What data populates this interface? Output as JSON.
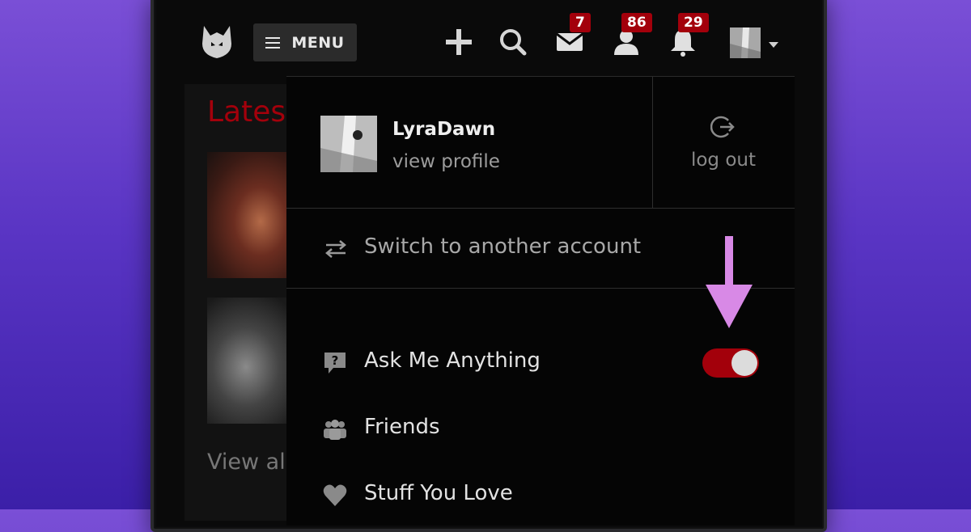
{
  "nav": {
    "menu_label": "MENU",
    "badges": {
      "messages": "7",
      "friends": "86",
      "notifications": "29"
    }
  },
  "background": {
    "heading": "Lates",
    "view_all": "View al"
  },
  "dropdown": {
    "username": "LyraDawn",
    "view_profile": "view profile",
    "log_out": "log out",
    "switch_account": "Switch to another account",
    "items": [
      {
        "label": "Ask Me Anything",
        "icon": "question-bubble-icon",
        "toggle": true,
        "toggle_on": true
      },
      {
        "label": "Friends",
        "icon": "friends-icon"
      },
      {
        "label": "Stuff You Love",
        "icon": "heart-icon"
      }
    ]
  },
  "colors": {
    "accent": "#a3000b",
    "annotation": "#d889e6",
    "background_gradient_top": "#7a4fd6",
    "background_gradient_bottom": "#3b1fa8"
  }
}
